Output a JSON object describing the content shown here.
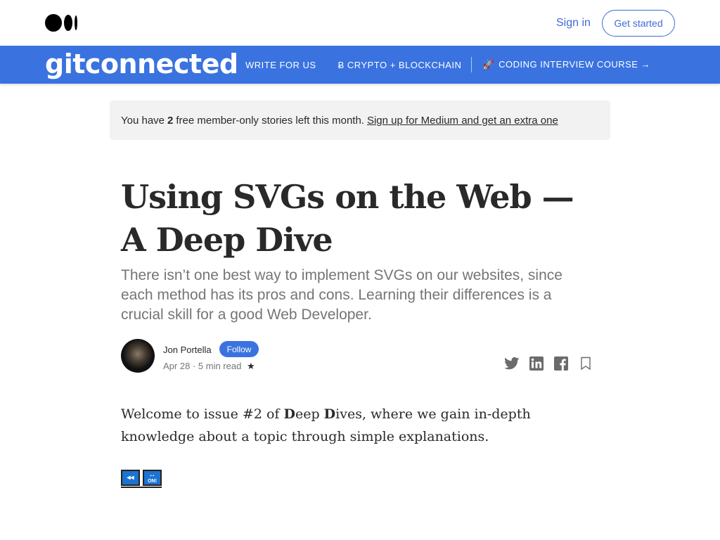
{
  "topbar": {
    "logo_icon": "medium-logo",
    "signin_label": "Sign in",
    "getstarted_label": "Get started"
  },
  "publication": {
    "name": "gitconnected",
    "links": [
      "WRITE FOR US",
      "Ƀ CRYPTO + BLOCKCHAIN"
    ],
    "course_link": "CODING INTERVIEW COURSE →",
    "color": "#3a73e0"
  },
  "banner": {
    "prefix": "You have",
    "count": "2",
    "suffix": "free member-only stories left this month.",
    "link": "Sign up for Medium and get an extra one"
  },
  "article": {
    "title": "Using SVGs on the Web — A Deep Dive",
    "subtitle": "There isn’t one best way to implement SVGs on our websites, since each method has its pros and cons. Learning their differences is a crucial skill for a good Web Developer.",
    "author": "Jon Portella",
    "follow_label": "Follow",
    "date": "Apr 28",
    "dot": "·",
    "read_time": "5 min read",
    "star": "★",
    "body_start": "Welcome to issue #2 of",
    "body_d1": "D",
    "body_eep": "eep",
    "body_d2": "D",
    "body_rest": "ives, where we gain in-depth knowledge about a topic through simple explanations."
  },
  "share": {
    "icons": [
      "twitter-icon",
      "linkedin-icon",
      "facebook-icon",
      "bookmark-icon"
    ]
  },
  "badges": {
    "rewind": "◂◂",
    "on_label": "ON!",
    "arrows": "↔"
  }
}
